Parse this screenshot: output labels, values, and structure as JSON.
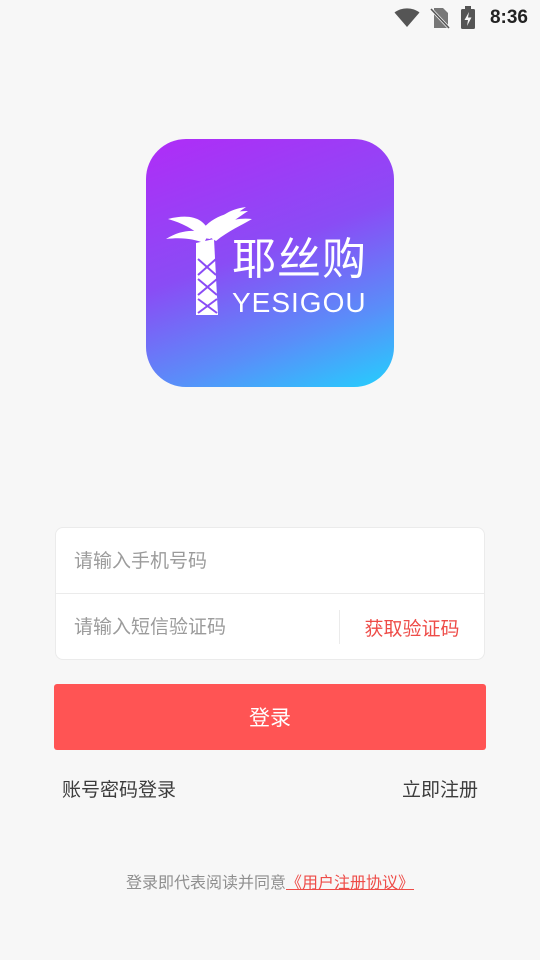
{
  "status_bar": {
    "time": "8:36",
    "icons": [
      "wifi-icon",
      "no-sim-icon",
      "battery-charging-icon"
    ]
  },
  "logo": {
    "brand_cn": "耶丝购",
    "brand_en": "YESIGOU",
    "colors": {
      "gradient_start": "#b02cf7",
      "gradient_end": "#24cffd"
    }
  },
  "form": {
    "phone_placeholder": "请输入手机号码",
    "code_placeholder": "请输入短信验证码",
    "get_code_label": "获取验证码"
  },
  "login_button_label": "登录",
  "links": {
    "password_login": "账号密码登录",
    "register": "立即注册"
  },
  "agreement": {
    "prefix": "登录即代表阅读并同意",
    "link": "《用户注册协议》"
  },
  "colors": {
    "accent": "#ff5454",
    "link_red": "#ee4c48",
    "background": "#f7f7f7"
  }
}
